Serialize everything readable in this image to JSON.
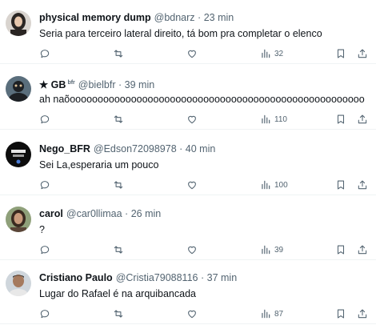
{
  "tweets": [
    {
      "name": "physical memory dump",
      "badge": "",
      "handle": "@bdnarz",
      "separator": "·",
      "time": "23 min",
      "text": "Seria para terceiro lateral direito, tá bom pra completar o elenco",
      "views": "32",
      "avatar_icon": "avatar-woman-dark-hair"
    },
    {
      "name": "★ GB",
      "badge": "bfr",
      "handle": "@bielbfr",
      "separator": "·",
      "time": "39 min",
      "text": "ah naõooooooooooooooooooooooooooooooooooooooooooooooooooooo",
      "views": "110",
      "avatar_icon": "avatar-dark-figure"
    },
    {
      "name": "Nego_BFR",
      "badge": "",
      "handle": "@Edson72098978",
      "separator": "·",
      "time": "40 min",
      "text": "Sei La,esperaria um pouco",
      "views": "100",
      "avatar_icon": "avatar-black-logo"
    },
    {
      "name": "carol",
      "badge": "",
      "handle": "@car0llimaa",
      "separator": "·",
      "time": "26 min",
      "text": "?",
      "views": "39",
      "avatar_icon": "avatar-woman-portrait"
    },
    {
      "name": "Cristiano Paulo",
      "badge": "",
      "handle": "@Cristia79088116",
      "separator": "·",
      "time": "37 min",
      "text": "Lugar do Rafael é na arquibancada",
      "views": "87",
      "avatar_icon": "avatar-man-portrait"
    }
  ],
  "colors": {
    "text": "#0f1419",
    "muted": "#536471",
    "divider": "#eff3f4"
  },
  "icons": [
    "reply-icon",
    "retweet-icon",
    "like-icon",
    "views-icon",
    "bookmark-icon",
    "share-icon"
  ]
}
